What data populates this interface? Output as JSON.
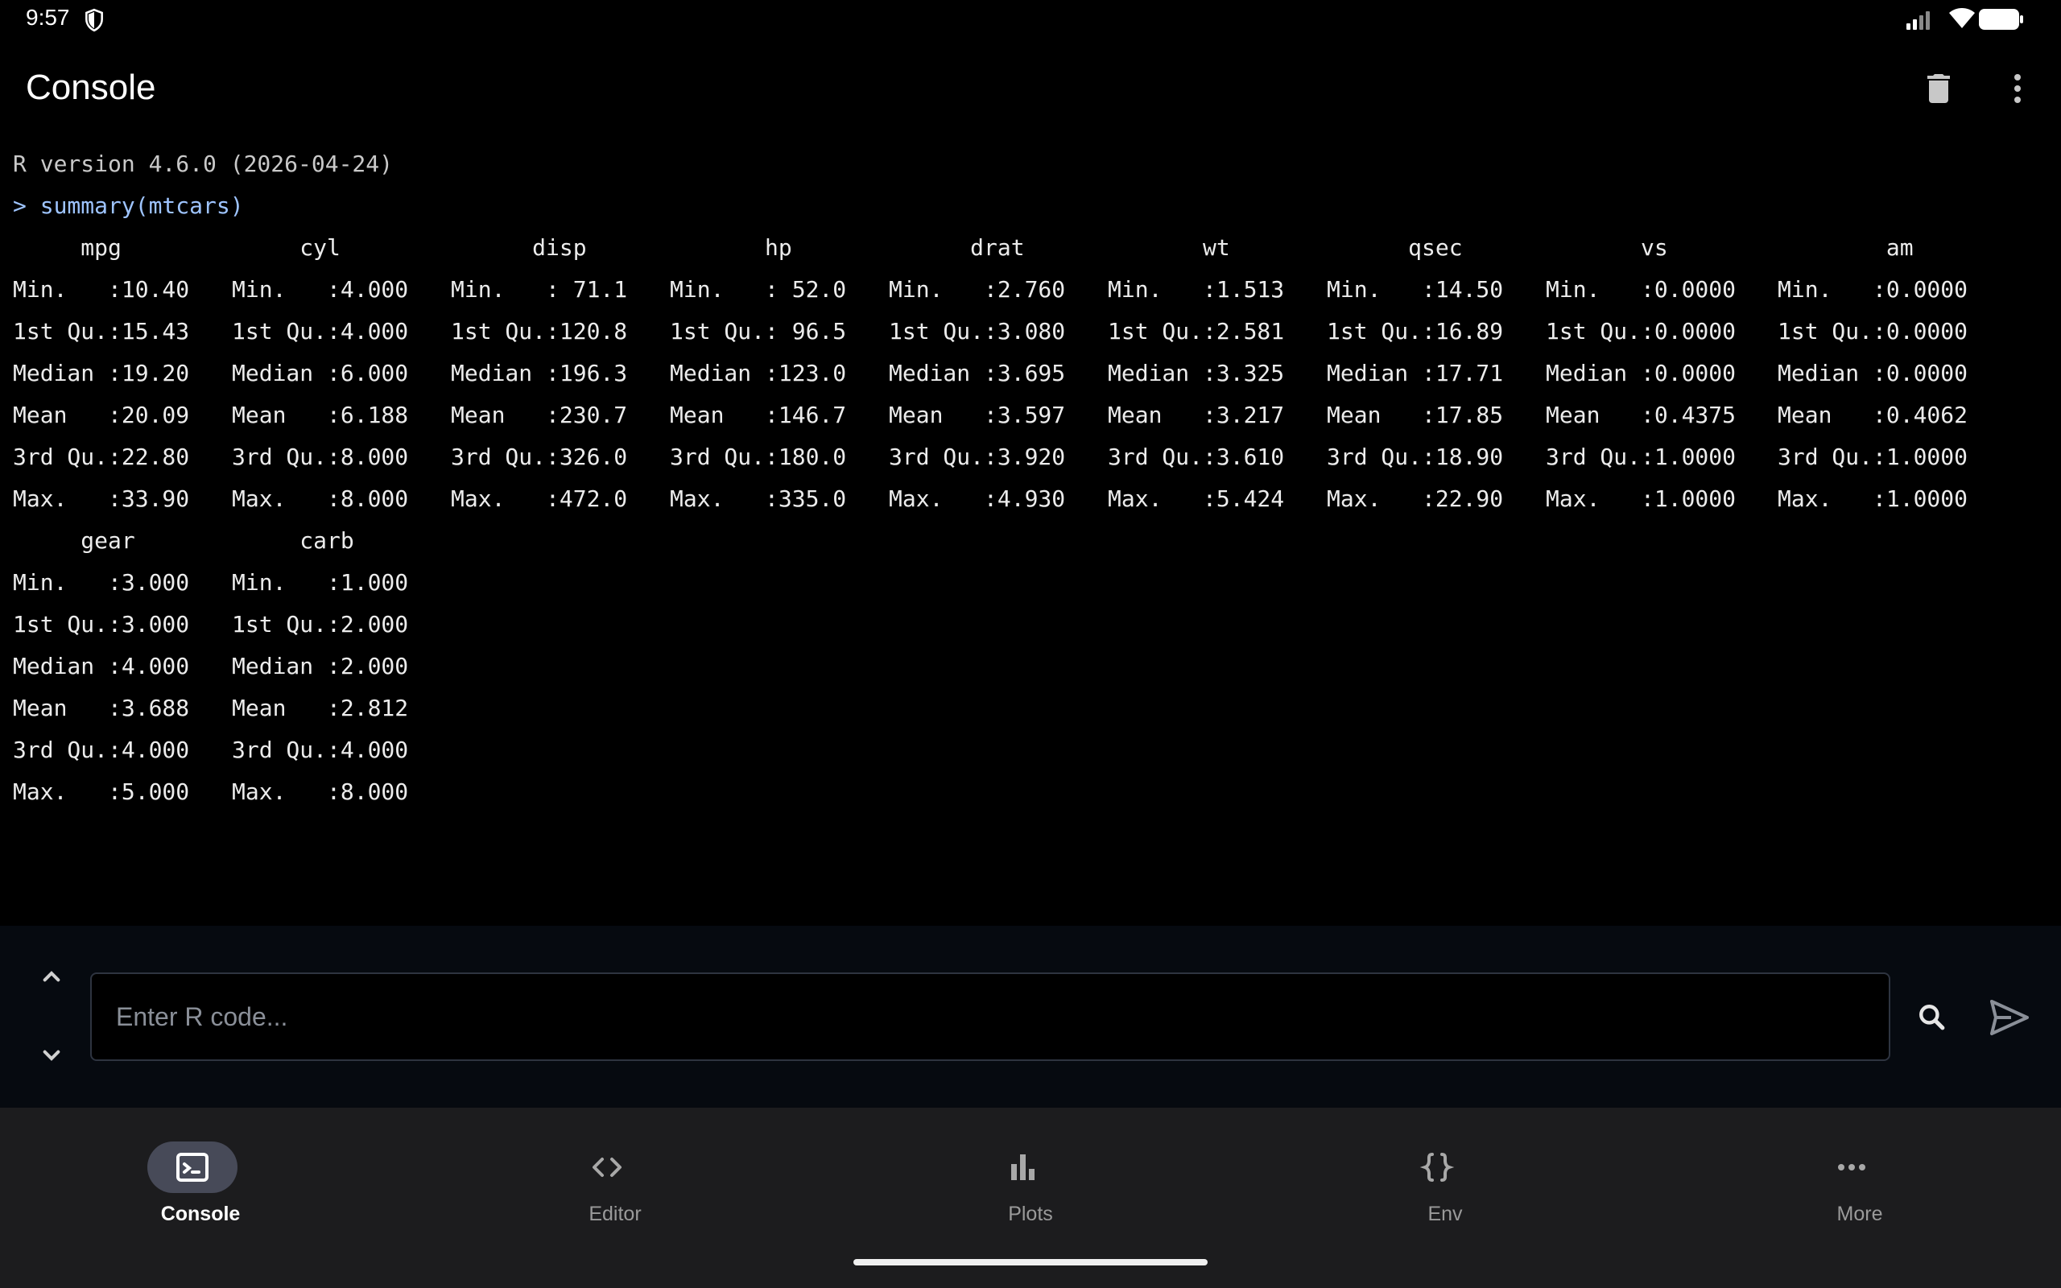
{
  "status": {
    "time": "9:57"
  },
  "app": {
    "title": "Console"
  },
  "console": {
    "version_line": "R version 4.6.0 (2026-04-24)",
    "prompt_line": "> summary(mtcars)",
    "tables": [
      {
        "columns": [
          {
            "header": "     mpg",
            "cells": [
              "Min.   :10.40",
              "1st Qu.:15.43",
              "Median :19.20",
              "Mean   :20.09",
              "3rd Qu.:22.80",
              "Max.   :33.90"
            ]
          },
          {
            "header": "     cyl",
            "cells": [
              "Min.   :4.000",
              "1st Qu.:4.000",
              "Median :6.000",
              "Mean   :6.188",
              "3rd Qu.:8.000",
              "Max.   :8.000"
            ]
          },
          {
            "header": "      disp",
            "cells": [
              "Min.   : 71.1",
              "1st Qu.:120.8",
              "Median :196.3",
              "Mean   :230.7",
              "3rd Qu.:326.0",
              "Max.   :472.0"
            ]
          },
          {
            "header": "       hp",
            "cells": [
              "Min.   : 52.0",
              "1st Qu.: 96.5",
              "Median :123.0",
              "Mean   :146.7",
              "3rd Qu.:180.0",
              "Max.   :335.0"
            ]
          },
          {
            "header": "      drat",
            "cells": [
              "Min.   :2.760",
              "1st Qu.:3.080",
              "Median :3.695",
              "Mean   :3.597",
              "3rd Qu.:3.920",
              "Max.   :4.930"
            ]
          },
          {
            "header": "       wt",
            "cells": [
              "Min.   :1.513",
              "1st Qu.:2.581",
              "Median :3.325",
              "Mean   :3.217",
              "3rd Qu.:3.610",
              "Max.   :5.424"
            ]
          },
          {
            "header": "      qsec",
            "cells": [
              "Min.   :14.50",
              "1st Qu.:16.89",
              "Median :17.71",
              "Mean   :17.85",
              "3rd Qu.:18.90",
              "Max.   :22.90"
            ]
          },
          {
            "header": "       vs",
            "cells": [
              "Min.   :0.0000",
              "1st Qu.:0.0000",
              "Median :0.0000",
              "Mean   :0.4375",
              "3rd Qu.:1.0000",
              "Max.   :1.0000"
            ]
          },
          {
            "header": "        am",
            "cells": [
              "Min.   :0.0000",
              "1st Qu.:0.0000",
              "Median :0.0000",
              "Mean   :0.4062",
              "3rd Qu.:1.0000",
              "Max.   :1.0000"
            ]
          }
        ]
      },
      {
        "columns": [
          {
            "header": "     gear",
            "cells": [
              "Min.   :3.000",
              "1st Qu.:3.000",
              "Median :4.000",
              "Mean   :3.688",
              "3rd Qu.:4.000",
              "Max.   :5.000"
            ]
          },
          {
            "header": "     carb",
            "cells": [
              "Min.   :1.000",
              "1st Qu.:2.000",
              "Median :2.000",
              "Mean   :2.812",
              "3rd Qu.:4.000",
              "Max.   :8.000"
            ]
          }
        ]
      }
    ]
  },
  "input": {
    "placeholder": "Enter R code..."
  },
  "nav": {
    "items": [
      {
        "label": "Console",
        "icon": "terminal-icon",
        "active": true
      },
      {
        "label": "Editor",
        "icon": "code-icon",
        "active": false
      },
      {
        "label": "Plots",
        "icon": "bar-chart-icon",
        "active": false
      },
      {
        "label": "Env",
        "icon": "braces-icon",
        "active": false
      },
      {
        "label": "More",
        "icon": "more-horizontal-icon",
        "active": false
      }
    ]
  },
  "colors": {
    "accent": "#9ec4ff",
    "nav_active_pill": "#474a58",
    "background": "#000000"
  }
}
